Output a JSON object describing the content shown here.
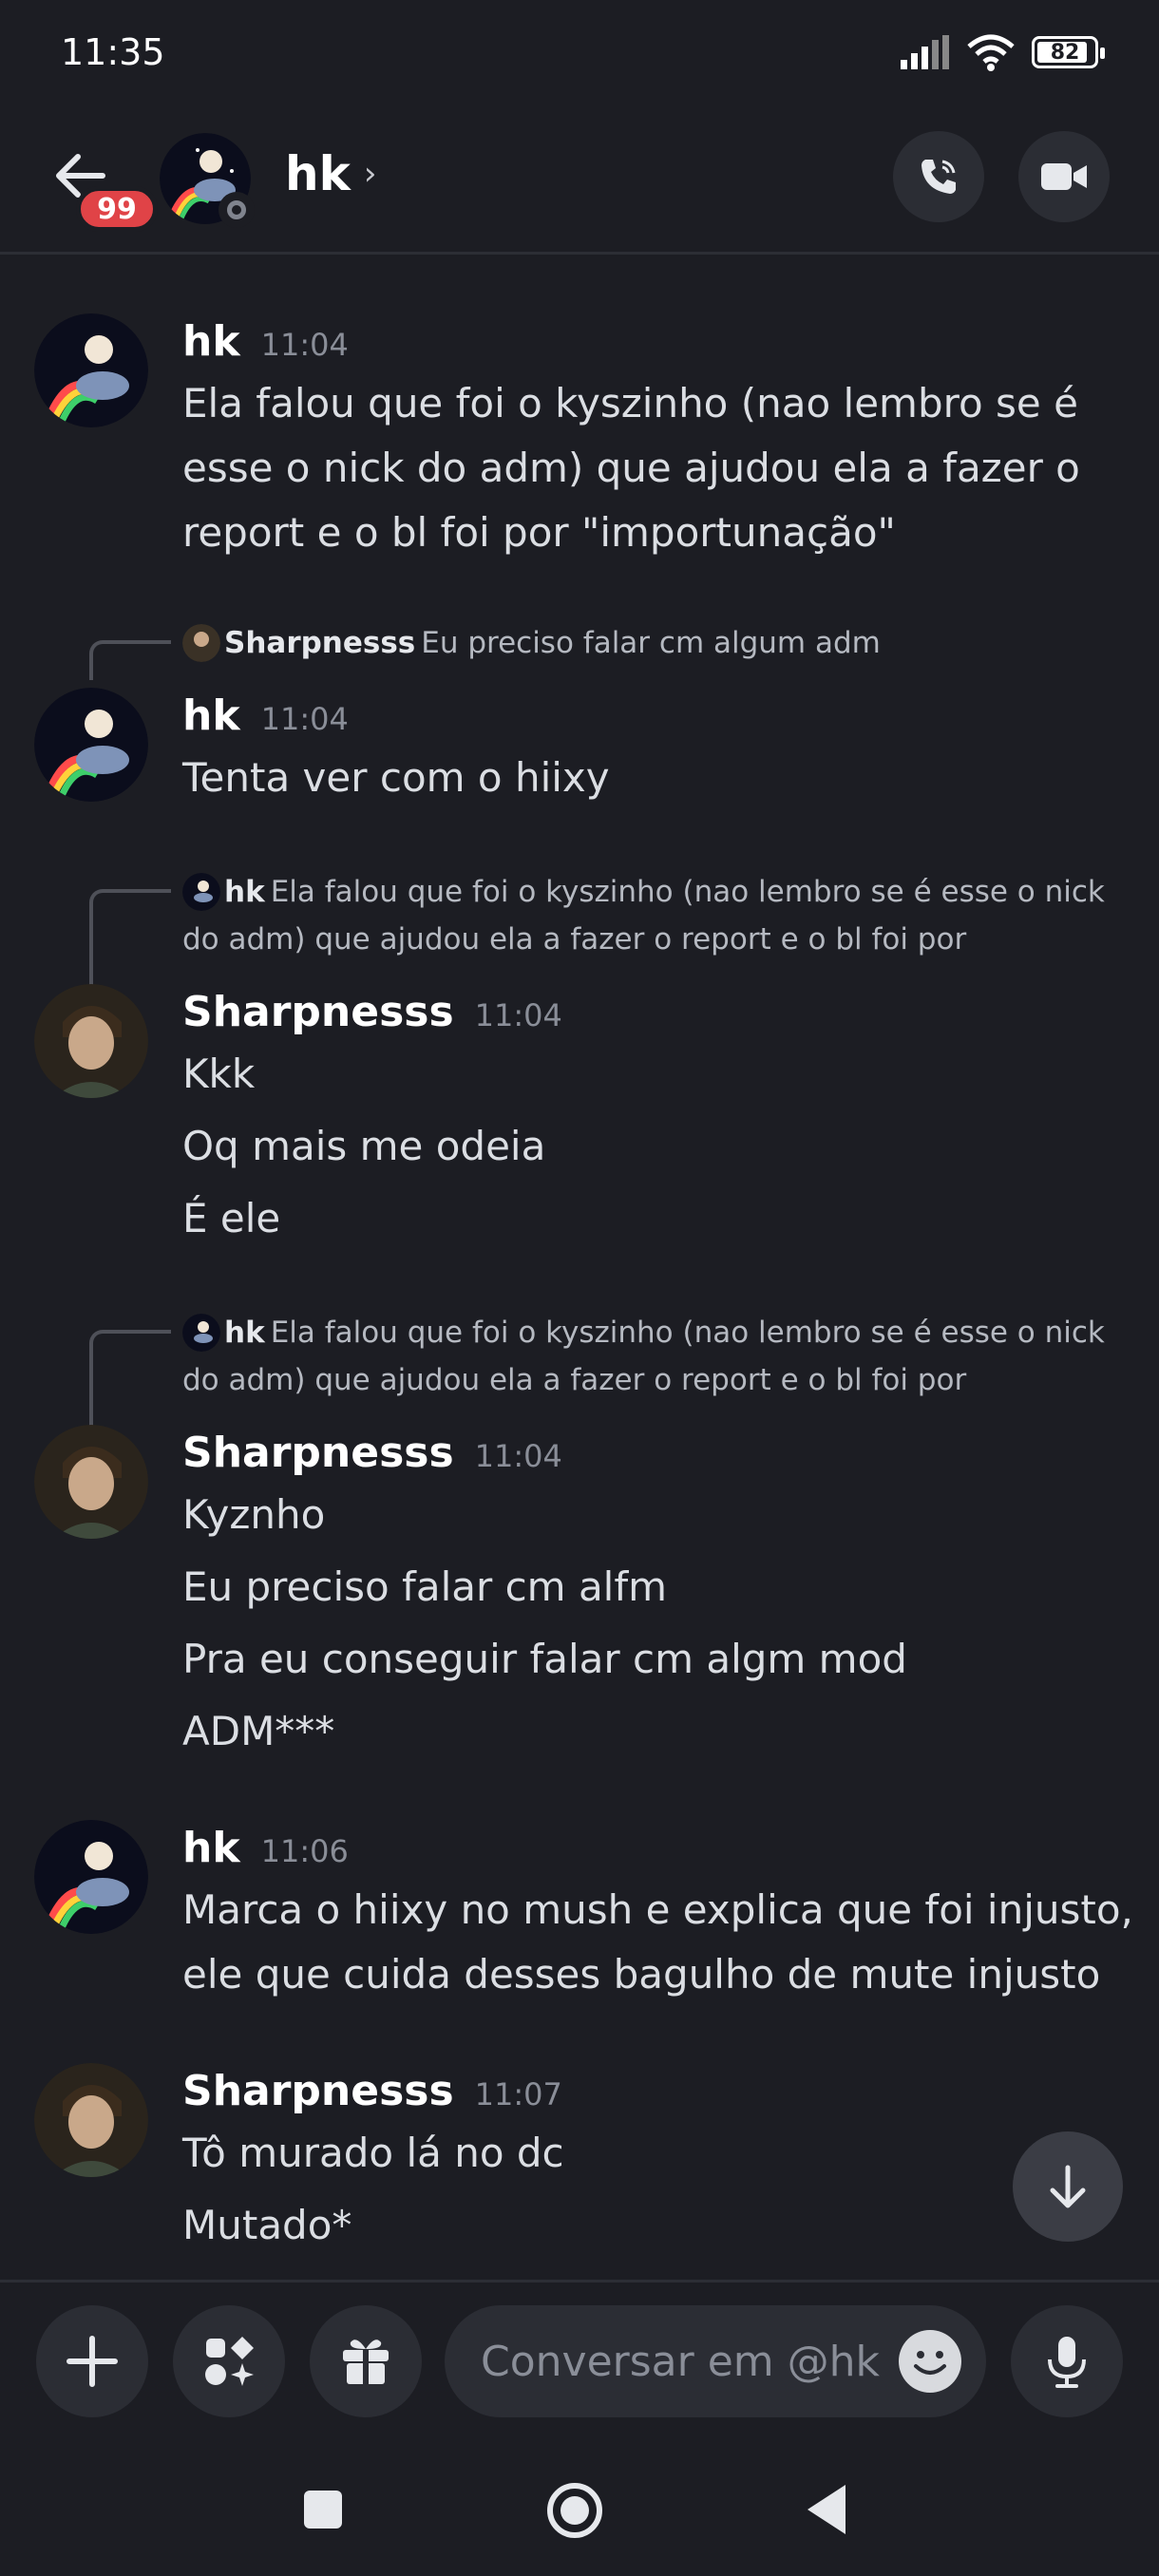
{
  "status_bar": {
    "time": "11:35",
    "battery": "82"
  },
  "header": {
    "badge": "99",
    "name": "hk",
    "chevron": "›"
  },
  "messages": {
    "m1": {
      "author": "hk",
      "time": "11:04",
      "lines": [
        "Ela falou que foi o kyszinho (nao lembro se é",
        "esse o nick do adm) que ajudou ela a fazer o",
        "report e o bl foi por \"importunação\""
      ]
    },
    "m2": {
      "reply_name": "Sharpnesss",
      "reply_text": "Eu preciso falar cm algum adm",
      "author": "hk",
      "time": "11:04",
      "lines": [
        "Tenta ver com o hiixy"
      ]
    },
    "m3": {
      "reply_name": "hk",
      "reply_text_1": "Ela falou que foi o kyszinho (nao lembro se é esse o nick",
      "reply_text_2": "do adm) que ajudou ela a fazer o report e o bl foi por",
      "author": "Sharpnesss",
      "time": "11:04",
      "lines": [
        "Kkk",
        "Oq mais me odeia",
        "É ele"
      ]
    },
    "m4": {
      "reply_name": "hk",
      "reply_text_1": "Ela falou que foi o kyszinho (nao lembro se é esse o nick",
      "reply_text_2": "do adm) que ajudou ela a fazer o report e o bl foi por",
      "author": "Sharpnesss",
      "time": "11:04",
      "lines": [
        "Kyznho",
        "Eu preciso falar cm alfm",
        "Pra eu conseguir falar cm algm mod",
        "ADM***"
      ]
    },
    "m5": {
      "author": "hk",
      "time": "11:06",
      "lines": [
        "Marca o hiixy no mush e explica que foi injusto,",
        "ele que cuida desses bagulho de mute injusto"
      ]
    },
    "m6": {
      "author": "Sharpnesss",
      "time": "11:07",
      "lines": [
        "Tô murado lá no dc",
        "Mutado*"
      ]
    }
  },
  "composer": {
    "placeholder": "Conversar em @hk"
  },
  "colors": {
    "background": "#1c1d23",
    "badge": "#e04347",
    "button": "#2b2d34"
  }
}
